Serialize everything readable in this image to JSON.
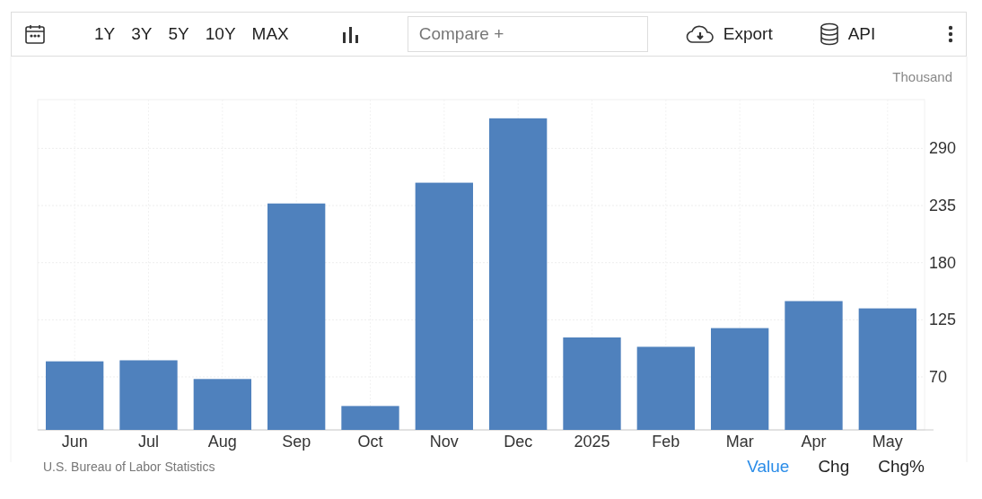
{
  "toolbar": {
    "ranges": [
      "1Y",
      "3Y",
      "5Y",
      "10Y",
      "MAX"
    ],
    "compare": {
      "placeholder": "Compare +"
    },
    "export": "Export",
    "api": "API"
  },
  "chart": {
    "unit": "Thousand",
    "chart_data": {
      "type": "bar",
      "categories": [
        "Jun",
        "Jul",
        "Aug",
        "Sep",
        "Oct",
        "Nov",
        "Dec",
        "2025",
        "Feb",
        "Mar",
        "Apr",
        "May"
      ],
      "grid": true,
      "series": [
        {
          "color": "#4f81bd",
          "values": [
            85,
            86,
            68,
            237,
            42,
            257,
            319,
            108,
            99,
            117,
            143,
            136
          ]
        }
      ],
      "ylim": [
        19,
        337
      ],
      "yticks": [
        70,
        125,
        180,
        235,
        290
      ]
    }
  },
  "footer": {
    "source": "U.S. Bureau of Labor Statistics",
    "views": [
      {
        "label": "Value",
        "selected": true
      },
      {
        "label": "Chg",
        "selected": false
      },
      {
        "label": "Chg%",
        "selected": false
      }
    ]
  }
}
